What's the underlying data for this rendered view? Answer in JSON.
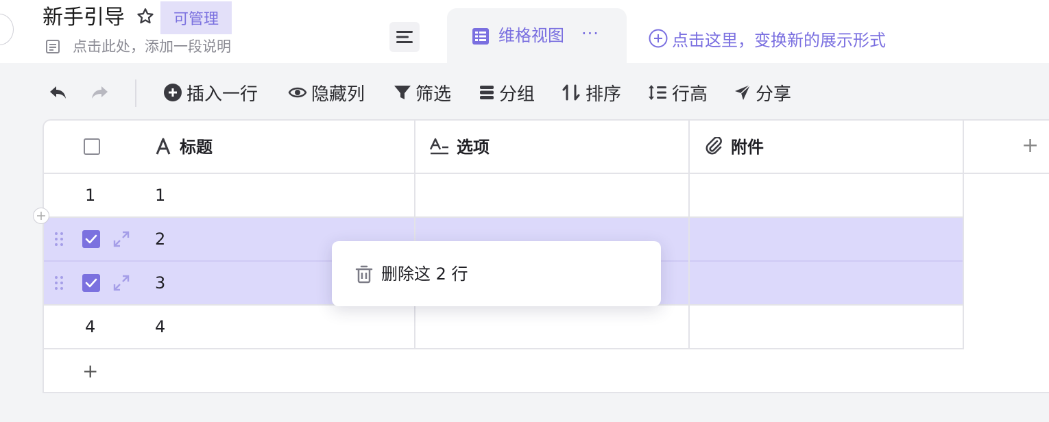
{
  "header": {
    "title": "新手引导",
    "badge": "可管理",
    "description_placeholder": "点击此处，添加一段说明"
  },
  "views": {
    "active_tab": "维格视图",
    "more": "···",
    "add_view_label": "点击这里，变换新的展示形式"
  },
  "toolbar": {
    "insert_row": "插入一行",
    "hide_columns": "隐藏列",
    "filter": "筛选",
    "group": "分组",
    "sort": "排序",
    "row_height": "行高",
    "share": "分享"
  },
  "table": {
    "columns": [
      "标题",
      "选项",
      "附件"
    ],
    "rows": [
      {
        "index": "1",
        "title": "1",
        "selected": false
      },
      {
        "index": "",
        "title": "2",
        "selected": true
      },
      {
        "index": "",
        "title": "3",
        "selected": true
      },
      {
        "index": "4",
        "title": "4",
        "selected": false
      }
    ],
    "add_row": "+",
    "add_column": "+"
  },
  "context_menu": {
    "delete_label": "删除这 2 行"
  },
  "colors": {
    "accent": "#7b71df",
    "selected_row": "#dcd9fb",
    "badge_bg": "#e3e0f9"
  }
}
